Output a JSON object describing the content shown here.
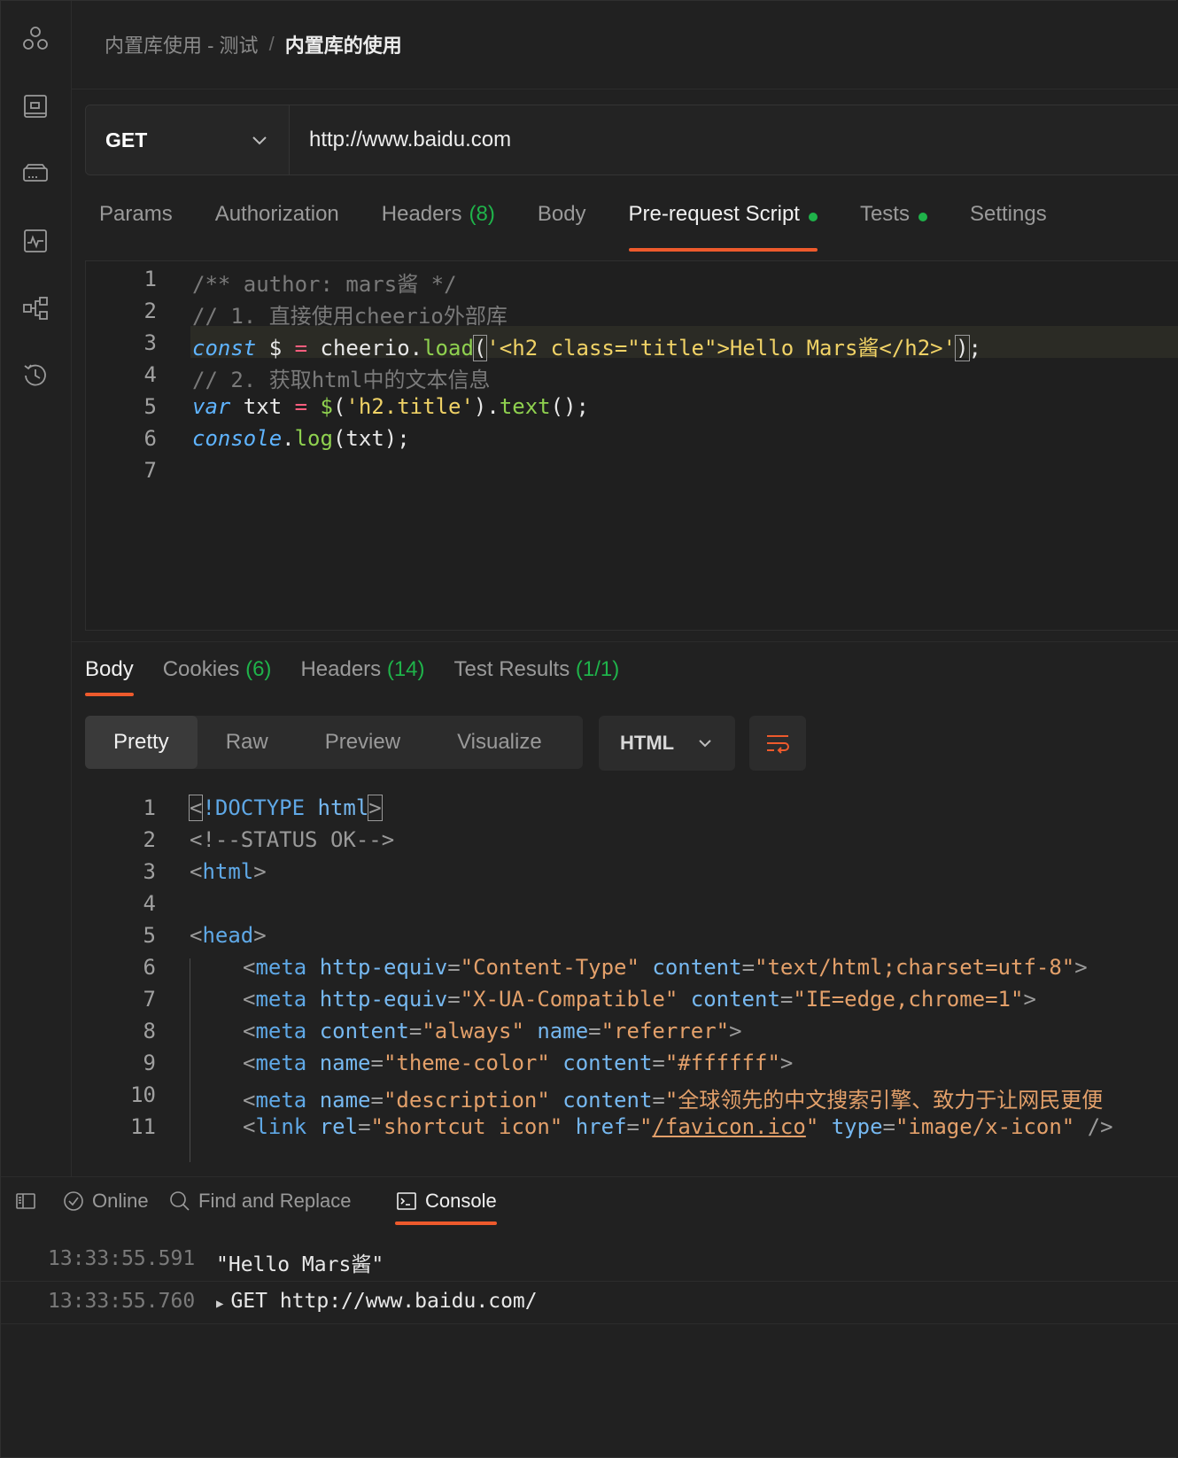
{
  "breadcrumb": {
    "parent": "内置库使用 - 测试",
    "separator": "/",
    "current": "内置库的使用"
  },
  "request": {
    "method": "GET",
    "url": "http://www.baidu.com"
  },
  "request_tabs": [
    {
      "label": "Params",
      "count": ""
    },
    {
      "label": "Authorization",
      "count": ""
    },
    {
      "label": "Headers",
      "count": "(8)"
    },
    {
      "label": "Body",
      "count": ""
    },
    {
      "label": "Pre-request Script",
      "count": "",
      "dot": true,
      "active": true
    },
    {
      "label": "Tests",
      "count": "",
      "dot": true
    },
    {
      "label": "Settings",
      "count": ""
    }
  ],
  "script": {
    "line_numbers": [
      "1",
      "2",
      "3",
      "4",
      "5",
      "6",
      "7"
    ],
    "lines": {
      "l1": "/** author: mars酱 */",
      "l2": "// 1. 直接使用cheerio外部库",
      "l3_kw": "const",
      "l3_var": " $ ",
      "l3_eq": "=",
      "l3_obj": " cheerio.",
      "l3_fn": "load",
      "l3_open": "(",
      "l3_str": "'<h2 class=\"title\">Hello Mars酱</h2>'",
      "l3_close": ")",
      "l3_end": ";",
      "l4": "// 2. 获取html中的文本信息",
      "l5_kw": "var",
      "l5_var": " txt ",
      "l5_eq": "=",
      "l5_fn1": " $",
      "l5_p1": "(",
      "l5_str": "'h2.title'",
      "l5_p2": ").",
      "l5_fn2": "text",
      "l5_end": "();",
      "l6_kw": "console",
      "l6_dot": ".",
      "l6_fn": "log",
      "l6_rest": "(txt);"
    }
  },
  "response_tabs": [
    {
      "label": "Body",
      "count": "",
      "active": true
    },
    {
      "label": "Cookies",
      "count": "(6)"
    },
    {
      "label": "Headers",
      "count": "(14)"
    },
    {
      "label": "Test Results",
      "count": "(1/1)"
    }
  ],
  "view_modes": [
    "Pretty",
    "Raw",
    "Preview",
    "Visualize"
  ],
  "active_view": "Pretty",
  "format": "HTML",
  "response_body": {
    "line_numbers": [
      "1",
      "2",
      "3",
      "4",
      "5",
      "6",
      "7",
      "8",
      "9",
      "10",
      "11"
    ],
    "l2": "<!--STATUS OK-->",
    "doctype": "!DOCTYPE",
    "html_word": "html",
    "head_word": "head",
    "meta": "meta",
    "link": "link",
    "a_http_equiv": "http-equiv",
    "a_content": "content",
    "a_name": "name",
    "a_rel": "rel",
    "a_href": "href",
    "a_type": "type",
    "v_content_type": "\"Content-Type\"",
    "v_charset": "\"text/html;charset=utf-8\"",
    "v_xua": "\"X-UA-Compatible\"",
    "v_ie": "\"IE=edge,chrome=1\"",
    "v_always": "\"always\"",
    "v_referrer": "\"referrer\"",
    "v_theme": "\"theme-color\"",
    "v_ffffff": "\"#ffffff\"",
    "v_description": "\"description\"",
    "v_desc_text": "\"全球领先的中文搜索引擎、致力于让网民更便",
    "v_shortcut": "\"shortcut icon\"",
    "v_favicon": "/favicon.ico",
    "v_xicon": "\"image/x-icon\"",
    "selfclose": "/>"
  },
  "status_bar": {
    "online": "Online",
    "find_replace": "Find and Replace",
    "console": "Console"
  },
  "console": [
    {
      "time": "13:33:55.591",
      "message": "\"Hello Mars酱\""
    },
    {
      "time": "13:33:55.760",
      "message": "GET http://www.baidu.com/"
    }
  ],
  "colors": {
    "accent": "#ee5a2c",
    "success": "#1fb34a",
    "background": "#212121"
  }
}
